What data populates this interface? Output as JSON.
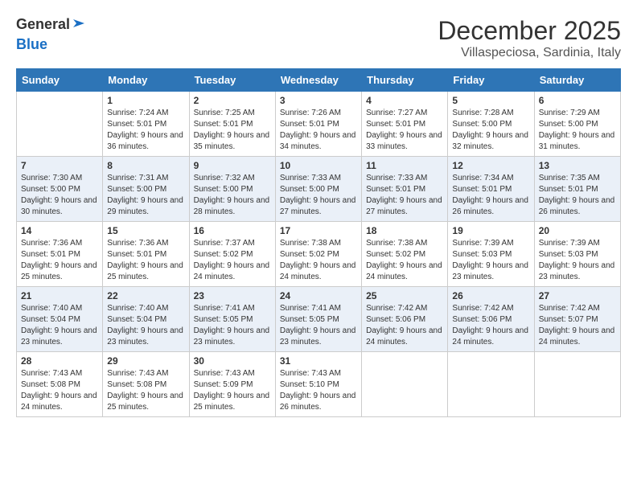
{
  "logo": {
    "text_general": "General",
    "text_blue": "Blue"
  },
  "title": "December 2025",
  "subtitle": "Villaspeciosa, Sardinia, Italy",
  "weekdays": [
    "Sunday",
    "Monday",
    "Tuesday",
    "Wednesday",
    "Thursday",
    "Friday",
    "Saturday"
  ],
  "weeks": [
    [
      {
        "day": "",
        "empty": true
      },
      {
        "day": "1",
        "sunrise": "7:24 AM",
        "sunset": "5:01 PM",
        "daylight": "9 hours and 36 minutes."
      },
      {
        "day": "2",
        "sunrise": "7:25 AM",
        "sunset": "5:01 PM",
        "daylight": "9 hours and 35 minutes."
      },
      {
        "day": "3",
        "sunrise": "7:26 AM",
        "sunset": "5:01 PM",
        "daylight": "9 hours and 34 minutes."
      },
      {
        "day": "4",
        "sunrise": "7:27 AM",
        "sunset": "5:01 PM",
        "daylight": "9 hours and 33 minutes."
      },
      {
        "day": "5",
        "sunrise": "7:28 AM",
        "sunset": "5:00 PM",
        "daylight": "9 hours and 32 minutes."
      },
      {
        "day": "6",
        "sunrise": "7:29 AM",
        "sunset": "5:00 PM",
        "daylight": "9 hours and 31 minutes."
      }
    ],
    [
      {
        "day": "7",
        "sunrise": "7:30 AM",
        "sunset": "5:00 PM",
        "daylight": "9 hours and 30 minutes."
      },
      {
        "day": "8",
        "sunrise": "7:31 AM",
        "sunset": "5:00 PM",
        "daylight": "9 hours and 29 minutes."
      },
      {
        "day": "9",
        "sunrise": "7:32 AM",
        "sunset": "5:00 PM",
        "daylight": "9 hours and 28 minutes."
      },
      {
        "day": "10",
        "sunrise": "7:33 AM",
        "sunset": "5:00 PM",
        "daylight": "9 hours and 27 minutes."
      },
      {
        "day": "11",
        "sunrise": "7:33 AM",
        "sunset": "5:01 PM",
        "daylight": "9 hours and 27 minutes."
      },
      {
        "day": "12",
        "sunrise": "7:34 AM",
        "sunset": "5:01 PM",
        "daylight": "9 hours and 26 minutes."
      },
      {
        "day": "13",
        "sunrise": "7:35 AM",
        "sunset": "5:01 PM",
        "daylight": "9 hours and 26 minutes."
      }
    ],
    [
      {
        "day": "14",
        "sunrise": "7:36 AM",
        "sunset": "5:01 PM",
        "daylight": "9 hours and 25 minutes."
      },
      {
        "day": "15",
        "sunrise": "7:36 AM",
        "sunset": "5:01 PM",
        "daylight": "9 hours and 25 minutes."
      },
      {
        "day": "16",
        "sunrise": "7:37 AM",
        "sunset": "5:02 PM",
        "daylight": "9 hours and 24 minutes."
      },
      {
        "day": "17",
        "sunrise": "7:38 AM",
        "sunset": "5:02 PM",
        "daylight": "9 hours and 24 minutes."
      },
      {
        "day": "18",
        "sunrise": "7:38 AM",
        "sunset": "5:02 PM",
        "daylight": "9 hours and 24 minutes."
      },
      {
        "day": "19",
        "sunrise": "7:39 AM",
        "sunset": "5:03 PM",
        "daylight": "9 hours and 23 minutes."
      },
      {
        "day": "20",
        "sunrise": "7:39 AM",
        "sunset": "5:03 PM",
        "daylight": "9 hours and 23 minutes."
      }
    ],
    [
      {
        "day": "21",
        "sunrise": "7:40 AM",
        "sunset": "5:04 PM",
        "daylight": "9 hours and 23 minutes."
      },
      {
        "day": "22",
        "sunrise": "7:40 AM",
        "sunset": "5:04 PM",
        "daylight": "9 hours and 23 minutes."
      },
      {
        "day": "23",
        "sunrise": "7:41 AM",
        "sunset": "5:05 PM",
        "daylight": "9 hours and 23 minutes."
      },
      {
        "day": "24",
        "sunrise": "7:41 AM",
        "sunset": "5:05 PM",
        "daylight": "9 hours and 23 minutes."
      },
      {
        "day": "25",
        "sunrise": "7:42 AM",
        "sunset": "5:06 PM",
        "daylight": "9 hours and 24 minutes."
      },
      {
        "day": "26",
        "sunrise": "7:42 AM",
        "sunset": "5:06 PM",
        "daylight": "9 hours and 24 minutes."
      },
      {
        "day": "27",
        "sunrise": "7:42 AM",
        "sunset": "5:07 PM",
        "daylight": "9 hours and 24 minutes."
      }
    ],
    [
      {
        "day": "28",
        "sunrise": "7:43 AM",
        "sunset": "5:08 PM",
        "daylight": "9 hours and 24 minutes."
      },
      {
        "day": "29",
        "sunrise": "7:43 AM",
        "sunset": "5:08 PM",
        "daylight": "9 hours and 25 minutes."
      },
      {
        "day": "30",
        "sunrise": "7:43 AM",
        "sunset": "5:09 PM",
        "daylight": "9 hours and 25 minutes."
      },
      {
        "day": "31",
        "sunrise": "7:43 AM",
        "sunset": "5:10 PM",
        "daylight": "9 hours and 26 minutes."
      },
      {
        "day": "",
        "empty": true
      },
      {
        "day": "",
        "empty": true
      },
      {
        "day": "",
        "empty": true
      }
    ]
  ],
  "cell_labels": {
    "sunrise": "Sunrise:",
    "sunset": "Sunset:",
    "daylight": "Daylight:"
  }
}
